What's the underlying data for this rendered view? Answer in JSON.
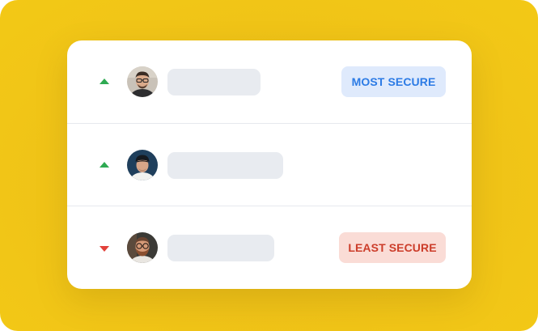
{
  "rows": [
    {
      "trend": "up",
      "trend_color": "#2eaa52",
      "avatar": "man-with-glasses-avatar",
      "badge": "MOST SECURE"
    },
    {
      "trend": "up",
      "trend_color": "#2eaa52",
      "avatar": "man-with-cap-avatar",
      "badge": ""
    },
    {
      "trend": "down",
      "trend_color": "#e2413a",
      "avatar": "man-with-beard-glasses-avatar",
      "badge": "LEAST SECURE"
    }
  ],
  "colors": {
    "background": "#f3c916",
    "most_secure_bg": "#dfeafc",
    "most_secure_text": "#2c7be5",
    "least_secure_bg": "#fadcd6",
    "least_secure_text": "#cc3d2a",
    "placeholder_bar": "#e8ebf0"
  }
}
